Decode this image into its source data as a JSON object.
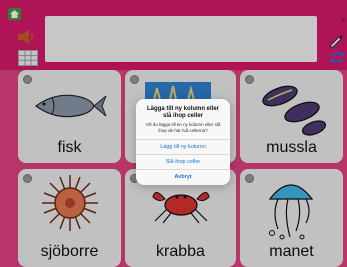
{
  "toolbar": {
    "home_icon": "home-icon",
    "speaker_icon": "speaker-icon",
    "grid_icon": "grid-icon",
    "text_value": "",
    "right_corner_text": "k",
    "pencil_icon": "pencil-icon",
    "sync_icon": "sync-icon"
  },
  "tiles": [
    {
      "label": "fisk",
      "icon": "fish-icon"
    },
    {
      "label": "",
      "icon": "coral-icon"
    },
    {
      "label": "mussla",
      "icon": "mussels-icon"
    },
    {
      "label": "sjöborre",
      "icon": "sea-urchin-icon"
    },
    {
      "label": "krabba",
      "icon": "crab-icon"
    },
    {
      "label": "manet",
      "icon": "jellyfish-icon"
    }
  ],
  "dialog": {
    "title": "Lägga till ny kolumn eller slå ihop celler",
    "message": "Vill du lägga till en ny kolumn eller slå ihop de här två cellerna?",
    "buttons": {
      "add_column": "Lägg till ny kolumn",
      "merge_cells": "Slå ihop celler",
      "cancel": "Avbryt"
    }
  },
  "colors": {
    "accent": "#d5196a",
    "dialog_button": "#1e73d9"
  }
}
